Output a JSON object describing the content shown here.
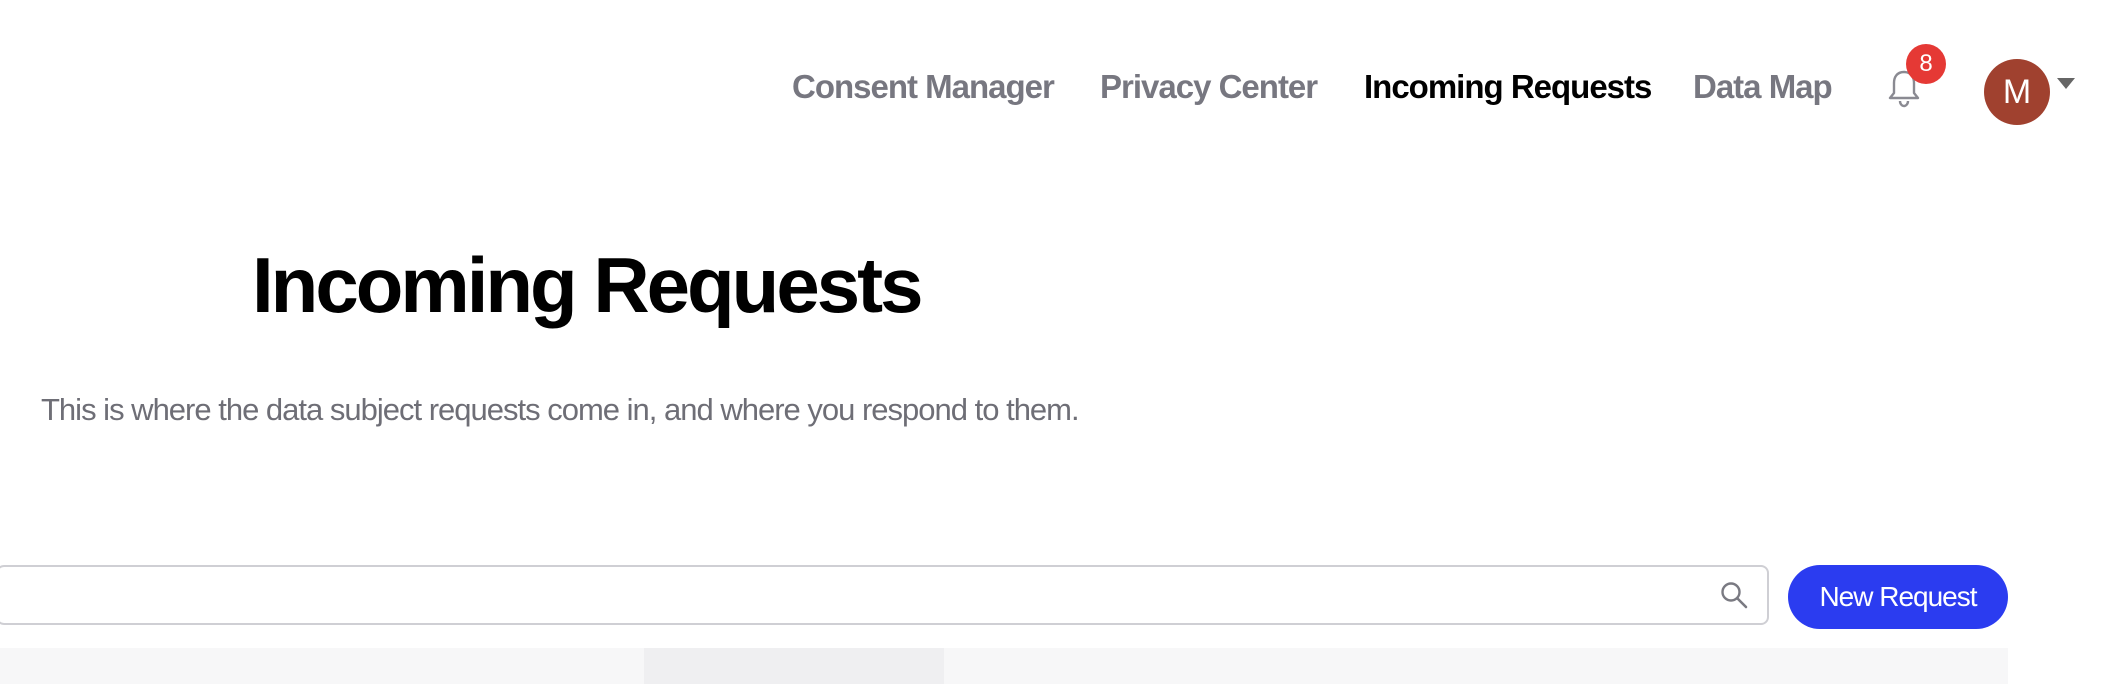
{
  "nav": {
    "items": [
      {
        "label": "Consent Manager",
        "active": false
      },
      {
        "label": "Privacy Center",
        "active": false
      },
      {
        "label": "Incoming Requests",
        "active": true
      },
      {
        "label": "Data Map",
        "active": false
      }
    ],
    "notifications": {
      "icon": "bell-icon",
      "count": "8"
    },
    "user": {
      "initial": "M",
      "avatar_color": "#a0412f",
      "menu_icon": "caret-down-icon"
    }
  },
  "main": {
    "title": "Incoming Requests",
    "description": "This is where the data subject requests come in, and where you respond to them."
  },
  "toolbar": {
    "search": {
      "value": "",
      "placeholder": "",
      "icon": "search-icon"
    },
    "new_request_label": "New Request"
  },
  "colors": {
    "accent": "#2b3cf0",
    "badge": "#e53935",
    "nav_inactive": "#777780",
    "nav_active": "#000000"
  }
}
